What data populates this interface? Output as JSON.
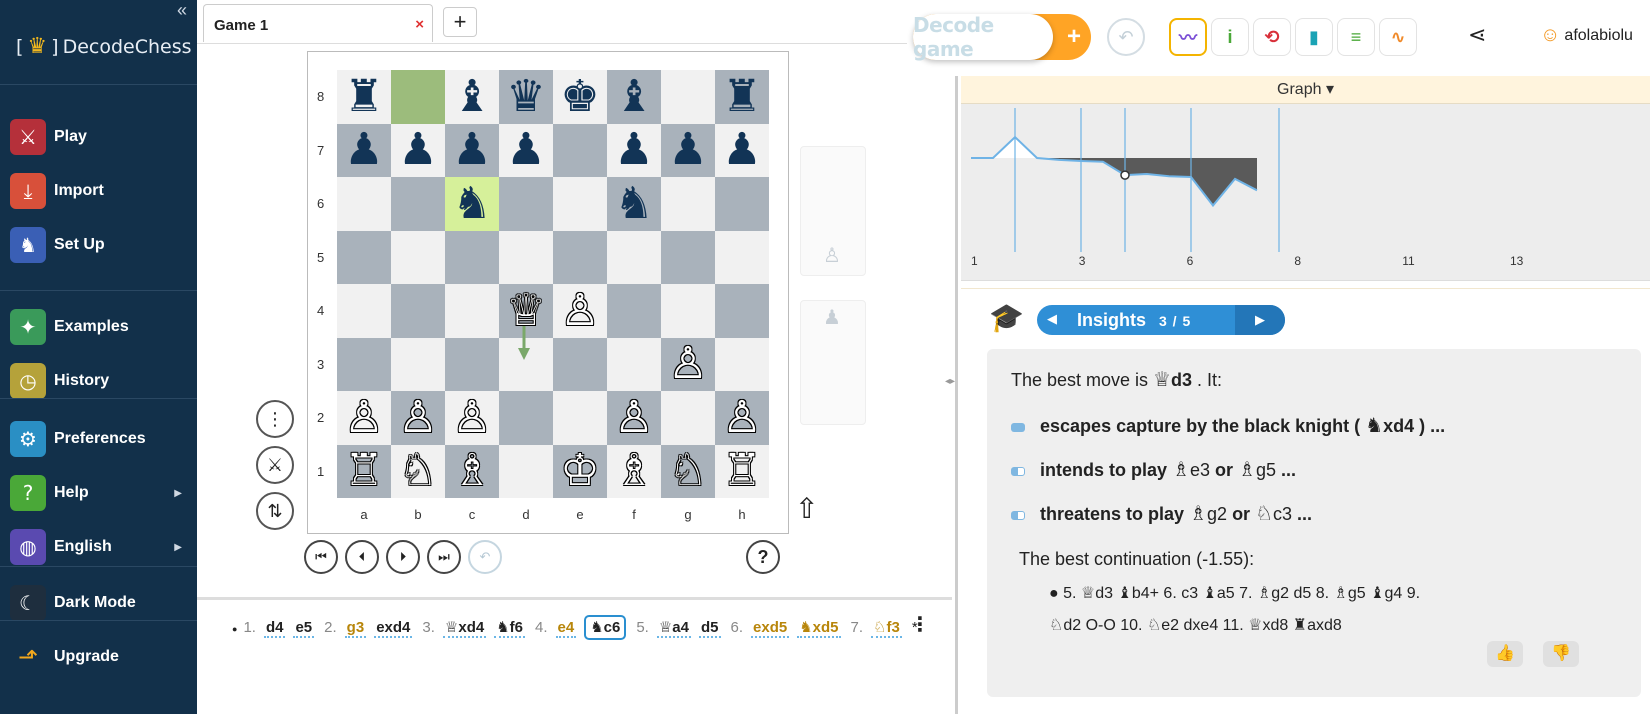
{
  "sidebar": {
    "collapse_glyph": "«",
    "logo_text": "DecodeChess",
    "items": [
      {
        "label": "Play",
        "icon": "sword-icon",
        "glyph": "⚔",
        "color": "#b5303a"
      },
      {
        "label": "Import",
        "icon": "import-icon",
        "glyph": "⤓",
        "color": "#d8503a"
      },
      {
        "label": "Set Up",
        "icon": "setup-icon",
        "glyph": "♞",
        "color": "#3a5fb5"
      },
      {
        "label": "Examples",
        "icon": "sparkles-icon",
        "glyph": "✦",
        "color": "#3a9a5a"
      },
      {
        "label": "History",
        "icon": "clock-icon",
        "glyph": "◷",
        "color": "#b5a23a"
      },
      {
        "label": "Preferences",
        "icon": "gear-icon",
        "glyph": "⚙",
        "color": "#2a8fc4"
      },
      {
        "label": "Help",
        "icon": "help-icon",
        "glyph": "?",
        "color": "#4aa838"
      },
      {
        "label": "English",
        "icon": "globe-icon",
        "glyph": "◍",
        "color": "#5a4ab0"
      },
      {
        "label": "Dark Mode",
        "icon": "moon-icon",
        "glyph": "☾",
        "color": "#1e2e3e"
      },
      {
        "label": "Upgrade",
        "icon": "upgrade-arrow-icon",
        "glyph": "⬏",
        "color": "#12304a"
      }
    ]
  },
  "tabs": {
    "game_tab": "Game 1",
    "close_glyph": "×",
    "add_glyph": "+"
  },
  "board": {
    "ranks": [
      "8",
      "7",
      "6",
      "5",
      "4",
      "3",
      "2",
      "1"
    ],
    "files": [
      "a",
      "b",
      "c",
      "d",
      "e",
      "f",
      "g",
      "h"
    ],
    "position": [
      [
        "♜",
        "",
        "♝",
        "♛",
        "♚",
        "♝",
        "",
        "♜"
      ],
      [
        "♟",
        "♟",
        "♟",
        "♟",
        "",
        "♟",
        "♟",
        "♟"
      ],
      [
        "",
        "",
        "♞",
        "",
        "",
        "♞",
        "",
        ""
      ],
      [
        "",
        "",
        "",
        "",
        "",
        "",
        "",
        ""
      ],
      [
        "",
        "",
        "",
        "♕",
        "♙",
        "",
        "",
        ""
      ],
      [
        "",
        "",
        "",
        "",
        "",
        "",
        "♙",
        ""
      ],
      [
        "♙",
        "♙",
        "♙",
        "",
        "",
        "♙",
        "",
        "♙"
      ],
      [
        "♖",
        "♘",
        "♗",
        "",
        "♔",
        "♗",
        "♘",
        "♖"
      ]
    ],
    "highlight_from": "b8",
    "highlight_to": "c6",
    "captured_top": "♙",
    "captured_bottom": "♟"
  },
  "board_controls": {
    "menu_glyph": "⋮",
    "swords_glyph": "⚔",
    "flip_glyph": "⇅",
    "first_glyph": "⏮",
    "prev_glyph": "⏴",
    "next_glyph": "⏵",
    "last_glyph": "⏭",
    "undo_glyph": "↶",
    "help_glyph": "?",
    "cursor_glyph": "⇧"
  },
  "moves": [
    {
      "num": "1.",
      "white": "d4",
      "black": "e5"
    },
    {
      "num": "2.",
      "white": "g3",
      "white_style": "gold",
      "black": "exd4"
    },
    {
      "num": "3.",
      "white": "♕xd4",
      "black": "♞f6"
    },
    {
      "num": "4.",
      "white": "e4",
      "white_style": "gold",
      "black": "♞c6",
      "black_style": "current"
    },
    {
      "num": "5.",
      "white": "♕a4",
      "black": "d5"
    },
    {
      "num": "6.",
      "white": "exd5",
      "white_style": "gold",
      "black": "♞xd5",
      "black_style": "gold"
    },
    {
      "num": "7.",
      "white": "♘f3",
      "white_style": "gold",
      "black": "*"
    }
  ],
  "moves_menu_glyph": "⋮",
  "toolbar": {
    "decode_label": "Decode game",
    "decode_plus": "+",
    "back_glyph": "↶",
    "tools": [
      {
        "name": "tool-graph",
        "glyph": "〰",
        "color": "#7b4fd6"
      },
      {
        "name": "tool-info",
        "glyph": "i",
        "color": "#4aa838"
      },
      {
        "name": "tool-fish",
        "glyph": "⟲",
        "color": "#d8303a"
      },
      {
        "name": "tool-bars",
        "glyph": "▮",
        "color": "#1aa3b5"
      },
      {
        "name": "tool-list",
        "glyph": "≡",
        "color": "#4aa838"
      },
      {
        "name": "tool-pulse",
        "glyph": "∿",
        "color": "#f08a2a"
      }
    ],
    "share_glyph": "⋖",
    "user_name": "afolabiolu",
    "user_glyph": "☺"
  },
  "graph": {
    "header_label": "Graph",
    "dropdown_glyph": "▾",
    "x_ticks": [
      "1",
      "3",
      "6",
      "8",
      "11",
      "13"
    ],
    "zero_level": 0.0,
    "values": [
      0.0,
      0.0,
      0.55,
      0.0,
      -0.05,
      -0.08,
      -0.1,
      -0.45,
      -0.42,
      -0.48,
      -0.5,
      -1.25,
      -0.55,
      -0.85
    ],
    "markers": [
      2,
      5,
      7,
      10,
      14
    ],
    "current": 7
  },
  "insights": {
    "title": "Insights",
    "count": "3 / 5",
    "prev_glyph": "◀",
    "next_glyph": "▶",
    "best_move_prefix": "The best move is",
    "best_move_fig": "♕",
    "best_move": "d3",
    "best_move_suffix": ". It:",
    "reasons": [
      {
        "text_a": "escapes capture by the black knight (",
        "fig": "♞",
        "move": "xd4",
        "text_b": ") ..."
      },
      {
        "text_a": "intends to play",
        "fig1": "♗",
        "m1": "e3",
        "or": "or",
        "fig2": "♗",
        "m2": "g5",
        "tail": "..."
      },
      {
        "text_a": "threatens to play",
        "fig1": "♗",
        "m1": "g2",
        "or": "or",
        "fig2": "♘",
        "m2": "c3",
        "tail": "..."
      }
    ],
    "continuation_label": "The best continuation (-1.55):",
    "continuation_line1": "5. ♕d3  ♝b4+  6. c3  ♝a5  7. ♗g2  d5  8. ♗g5  ♝g4  9.",
    "continuation_line2": "♘d2  O-O  10. ♘e2  dxe4  11. ♕xd8  ♜axd8",
    "thumb_up": "👍",
    "thumb_down": "👎"
  }
}
